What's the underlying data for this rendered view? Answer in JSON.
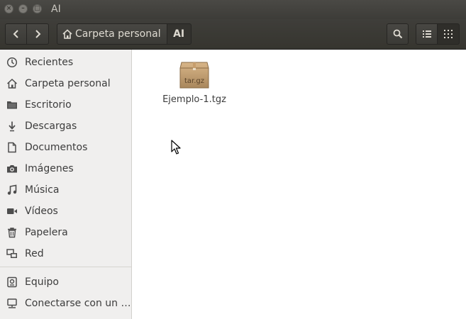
{
  "window": {
    "title": "AI"
  },
  "header": {
    "breadcrumbs": [
      "Carpeta personal",
      "AI"
    ]
  },
  "sidebar": {
    "items": [
      {
        "label": "Recientes",
        "icon": "clock-icon"
      },
      {
        "label": "Carpeta personal",
        "icon": "home-icon"
      },
      {
        "label": "Escritorio",
        "icon": "folder-icon"
      },
      {
        "label": "Descargas",
        "icon": "download-icon"
      },
      {
        "label": "Documentos",
        "icon": "document-icon"
      },
      {
        "label": "Imágenes",
        "icon": "camera-icon"
      },
      {
        "label": "Música",
        "icon": "music-icon"
      },
      {
        "label": "Vídeos",
        "icon": "video-icon"
      },
      {
        "label": "Papelera",
        "icon": "trash-icon"
      },
      {
        "label": "Red",
        "icon": "network-icon"
      },
      {
        "label": "Equipo",
        "icon": "drive-icon"
      },
      {
        "label": "Conectarse con un …",
        "icon": "server-icon"
      }
    ]
  },
  "files": [
    {
      "name": "Ejemplo-1.tgz",
      "badge": "tar.gz",
      "icon": "archive-icon"
    }
  ]
}
